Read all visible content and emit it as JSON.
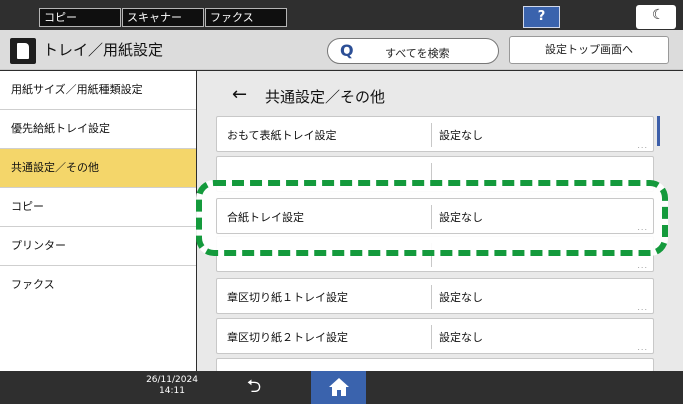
{
  "top_tabs": [
    "コピー",
    "スキャナー",
    "ファクス"
  ],
  "help_label": "?",
  "night_icon": "moon-icon",
  "header": {
    "title": "トレイ／用紙設定",
    "search_label": "すべてを検索",
    "top_menu_label": "設定トップ画面へ"
  },
  "sidebar": {
    "items": [
      "用紙サイズ／用紙種類設定",
      "優先給紙トレイ設定",
      "共通設定／その他",
      "コピー",
      "プリンター",
      "ファクス"
    ],
    "active_index": 2
  },
  "content": {
    "section_title": "共通設定／その他",
    "rows": [
      {
        "name": "おもて表紙トレイ設定",
        "value": "設定なし"
      },
      {
        "name": "",
        "value": ""
      },
      {
        "name": "合紙トレイ設定",
        "value": "設定なし"
      },
      {
        "name": "",
        "value": ""
      },
      {
        "name": "章区切り紙１トレイ設定",
        "value": "設定なし"
      },
      {
        "name": "章区切り紙２トレイ設定",
        "value": "設定なし"
      }
    ],
    "more_glyph": "..."
  },
  "footer": {
    "date": "26/11/2024",
    "time": "14:11"
  },
  "colors": {
    "accent_blue": "#3a63ad",
    "active_yellow": "#f4d66a",
    "highlight_green": "#149a3c"
  }
}
